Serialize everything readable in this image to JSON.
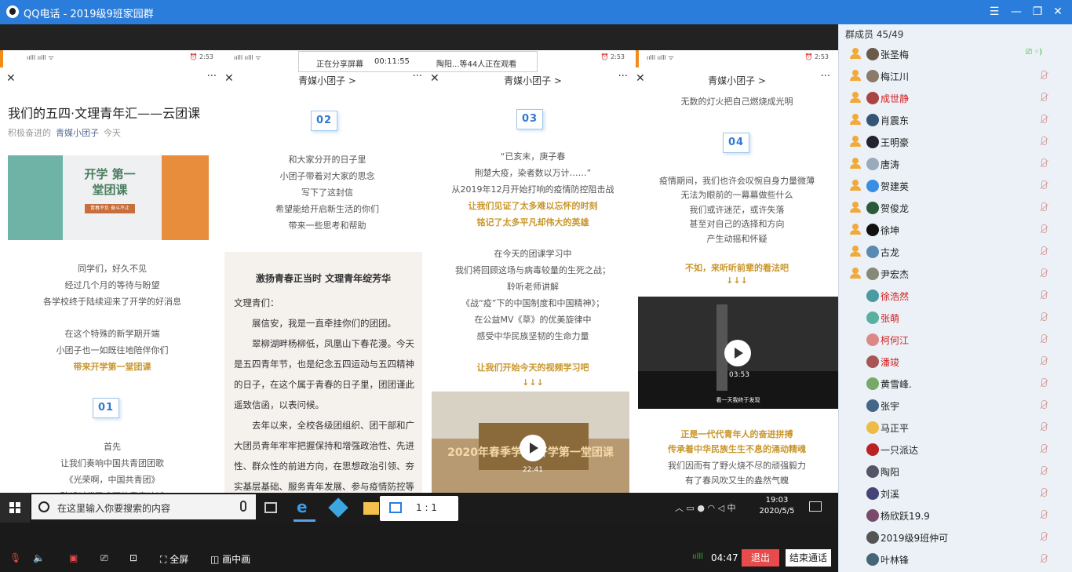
{
  "window": {
    "title": "QQ电话 - 2019级9班家园群"
  },
  "share": {
    "status": "正在分享屏幕",
    "duration": "00:11:55",
    "viewers": "陶阳...等44人正在观看"
  },
  "phone_status": {
    "signal": "ıılll ıılll ᯤ",
    "time": "⏰ 2:53"
  },
  "panel1": {
    "title": "我们的五四·文理青年汇——云团课",
    "meta_tag": "积极奋进的",
    "meta_account": "青媒小团子",
    "meta_date": "今天",
    "banner_title": "开学 第一堂团课",
    "banner_sub": "青春不负 奋斗不止",
    "lines": [
      "同学们，好久不见",
      "经过几个月的等待与盼望",
      "各学校终于陆续迎来了开学的好消息",
      "在这个特殊的新学期开端",
      "小团子也一如既往地陪伴你们",
      "带来开学第一堂团课"
    ],
    "num": "01",
    "lines2": [
      "首先",
      "让我们奏响中国共青团团歌",
      "《光荣啊，中国共青团》",
      "聆听时代召唤下的青春呐喊"
    ]
  },
  "panel2": {
    "nav_title": "青媒小团子 >",
    "num": "02",
    "lines": [
      "和大家分开的日子里",
      "小团子带着对大家的思念",
      "写下了这封信",
      "希望能给开启新生活的你们",
      "带来一些思考和帮助"
    ],
    "letter_title": "激扬青春正当时 文理青年绽芳华",
    "letter_body": "文理青们：\n　　展信安，我是一直牵挂你们的团团。\n　　翠柳湖畔杨柳低，凤凰山下春花漫。今天是五四青年节，也是纪念五四运动与五四精神的日子，在这个属于青春的日子里，团团谨此遥致信函，以表问候。\n　　去年以来，全校各级团组织、团干部和广大团员青年牢牢把握保持和增强政治性、先进性、群众性的前进方向，在思想政治引领、夯实基层基础、服务青年发展、参与疫情防控等"
  },
  "panel3": {
    "nav_title": "青媒小团子 >",
    "num": "03",
    "lines": [
      "“已亥末，庚子春",
      "荆楚大疫，染者数以万计……”",
      "从2019年12月开始打响的疫情防控阻击战"
    ],
    "gold1": [
      "让我们见证了太多难以忘怀的时刻",
      "铭记了太多平凡却伟大的英雄"
    ],
    "lines2": [
      "在今天的团课学习中",
      "我们将回顾这场与病毒较量的生死之战；",
      "聆听老师讲解",
      "《战“疫”下的中国制度和中国精神》；",
      "在公益MV《草》的优美旋律中",
      "感受中华民族坚韧的生命力量"
    ],
    "gold2": [
      "让我们开始今天的视频学习吧",
      "↓↓↓"
    ],
    "video_caption": "2020年春季学期 开学第一堂团课",
    "video_time": "22:41"
  },
  "panel4": {
    "nav_title": "青媒小团子 >",
    "top_line": "无数的灯火把自己燃烧成光明",
    "num": "04",
    "lines": [
      "疫情期间，我们也许会叹惋自身力量微薄",
      "无法为眼前的一幕幕做些什么",
      "我们或许迷茫，或许失落",
      "甚至对自己的选择和方向",
      "产生动摇和怀疑"
    ],
    "gold1": [
      "不如，来听听前辈的看法吧",
      "↓↓↓"
    ],
    "video_time": "03:53",
    "video_sub": "看一天我终于发现",
    "gold2": [
      "正是一代代青年人的奋进拼搏",
      "传承着中华民族生生不息的涌动精魂"
    ],
    "lines2": [
      "我们因而有了野火烧不尽的顽强毅力",
      "有了春风吹又生的盎然气魄"
    ]
  },
  "taskbar": {
    "search_placeholder": "在这里输入你要搜索的内容",
    "ratio": "1 : 1",
    "time": "19:03",
    "date": "2020/5/5"
  },
  "controls": {
    "fullscreen": "全屏",
    "pip": "画中画",
    "duration": "04:47",
    "leave": "退出",
    "end": "结束通话"
  },
  "members": {
    "header": "群成员 45/49",
    "list": [
      {
        "name": "张圣梅",
        "red": false,
        "role": true,
        "live": true
      },
      {
        "name": "梅江川",
        "red": false,
        "role": true
      },
      {
        "name": "成世静",
        "red": true,
        "role": true
      },
      {
        "name": "肖震东",
        "red": false,
        "role": true
      },
      {
        "name": "王明豪",
        "red": false,
        "role": true
      },
      {
        "name": "唐涛",
        "red": false,
        "role": true
      },
      {
        "name": "贺建英",
        "red": false,
        "role": true
      },
      {
        "name": "贺俊龙",
        "red": false,
        "role": true
      },
      {
        "name": "徐坤",
        "red": false,
        "role": true
      },
      {
        "name": "古龙",
        "red": false,
        "role": true
      },
      {
        "name": "尹宏杰",
        "red": false,
        "role": true
      },
      {
        "name": "徐浩然",
        "red": true,
        "role": false
      },
      {
        "name": "张萌",
        "red": true,
        "role": false
      },
      {
        "name": "柯何江",
        "red": true,
        "role": false
      },
      {
        "name": "潘竣",
        "red": true,
        "role": false
      },
      {
        "name": "黄雪峰.",
        "red": false,
        "role": false
      },
      {
        "name": "张宇",
        "red": false,
        "role": false
      },
      {
        "name": "马正平",
        "red": false,
        "role": false
      },
      {
        "name": "一只派达",
        "red": false,
        "role": false
      },
      {
        "name": "陶阳",
        "red": false,
        "role": false
      },
      {
        "name": "刘溪",
        "red": false,
        "role": false
      },
      {
        "name": "杨欣跃19.9",
        "red": false,
        "role": false
      },
      {
        "name": "2019级9班仲可",
        "red": false,
        "role": false
      },
      {
        "name": "叶林锋",
        "red": false,
        "role": false
      }
    ]
  }
}
